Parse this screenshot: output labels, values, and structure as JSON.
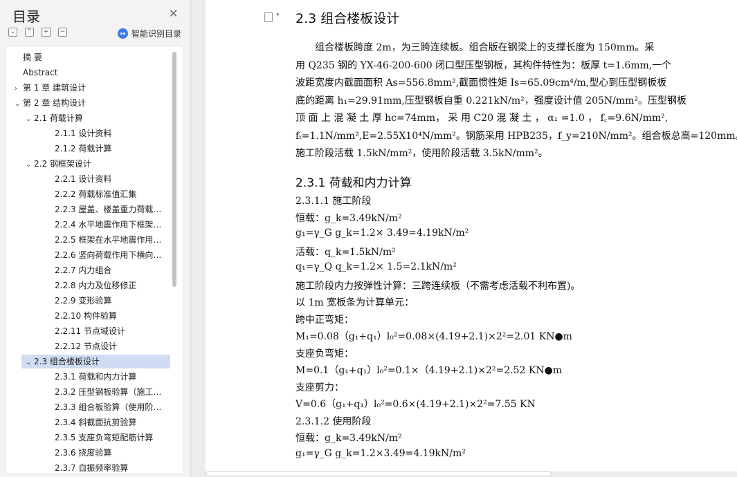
{
  "sidebar": {
    "title": "目录",
    "smart_label": "智能识别目录",
    "items": [
      {
        "label": "摘  要",
        "level": 0,
        "arrow": ""
      },
      {
        "label": "Abstract",
        "level": 0,
        "arrow": ""
      },
      {
        "label": "第 1 章  建筑设计",
        "level": 0,
        "arrow": "›"
      },
      {
        "label": "第 2 章  结构设计",
        "level": 0,
        "arrow": "⌄"
      },
      {
        "label": "2.1  荷载计算",
        "level": 1,
        "arrow": "⌄"
      },
      {
        "label": "2.1.1  设计资料",
        "level": 2,
        "arrow": ""
      },
      {
        "label": "2.1.2  荷载计算",
        "level": 2,
        "arrow": ""
      },
      {
        "label": "2.2  钢框架设计",
        "level": 1,
        "arrow": "⌄"
      },
      {
        "label": "2.2.1  设计资料",
        "level": 2,
        "arrow": ""
      },
      {
        "label": "2.2.2  荷载标准值汇集",
        "level": 2,
        "arrow": ""
      },
      {
        "label": "2.2.3  屋盖、楼盖重力荷载代…",
        "level": 2,
        "arrow": ""
      },
      {
        "label": "2.2.4  水平地震作用下框架的…",
        "level": 2,
        "arrow": ""
      },
      {
        "label": "2.2.5  框架在水平地震作用下…",
        "level": 2,
        "arrow": ""
      },
      {
        "label": "2.2.6  竖向荷载作用下横向框…",
        "level": 2,
        "arrow": ""
      },
      {
        "label": "2.2.7  内力组合",
        "level": 2,
        "arrow": ""
      },
      {
        "label": "2.2.8  内力及位移修正",
        "level": 2,
        "arrow": ""
      },
      {
        "label": "2.2.9  变形验算",
        "level": 2,
        "arrow": ""
      },
      {
        "label": "2.2.10  构件验算",
        "level": 2,
        "arrow": ""
      },
      {
        "label": "2.2.11  节点域设计",
        "level": 2,
        "arrow": ""
      },
      {
        "label": "2.2.12  节点设计",
        "level": 2,
        "arrow": ""
      },
      {
        "label": "2.3  组合楼板设计",
        "level": 1,
        "arrow": "⌄",
        "active": true
      },
      {
        "label": "2.3.1  荷载和内力计算",
        "level": 2,
        "arrow": ""
      },
      {
        "label": "2.3.2  压型钢板验算（施工阶…",
        "level": 2,
        "arrow": ""
      },
      {
        "label": "2.3.3  组合板验算（使用阶段…",
        "level": 2,
        "arrow": ""
      },
      {
        "label": "2.3.4  斜截面抗剪验算",
        "level": 2,
        "arrow": ""
      },
      {
        "label": "2.3.5  支座负弯矩配筋计算",
        "level": 2,
        "arrow": ""
      },
      {
        "label": "2.3.6  挠度验算",
        "level": 2,
        "arrow": ""
      },
      {
        "label": "2.3.7  自振频率验算",
        "level": 2,
        "arrow": ""
      }
    ]
  },
  "doc": {
    "heading": "2.3  组合楼板设计",
    "para": [
      "　　组合楼板跨度 2m，为三跨连续板。组合版在钢梁上的支撑长度为 150mm。采",
      "用 Q235 钢的 YX-46-200-600 闭口型压型钢板，其构件特性为：板厚 t=1.6mm,一个",
      "波距宽度内截面面积 As=556.8mm²,截面惯性矩 Is=65.09cm⁴/m,型心到压型钢板板",
      "底的距离 h₁=29.91mm,压型钢板自重 0.221kN/m²，强度设计值 205N/mm²。压型钢板",
      "顶 面 上 混 凝 土 厚  hc=74mm， 采 用  C20  混 凝 土 ，  α₁ =1.0 ，  f꜀=9.6N/mm²,",
      "fₜ=1.1N/mm²,E=2.55X10⁴N/mm²。钢筋采用 HPB235，f_y=210N/mm²。组合板总高=120mm。",
      "施工阶段活载 1.5kN/mm²，使用阶段活载 3.5kN/mm²。"
    ],
    "sub_heading": "2.3.1  荷载和内力计算",
    "lines": [
      "2.3.1.1   施工阶段",
      "恒载：g_k=3.49kN/m²",
      "g₁=γ_G g_k=1.2× 3.49=4.19kN/m²",
      "活载：q_k=1.5kN/m²",
      "q₁=γ_Q q_k=1.2× 1.5=2.1kN/m²",
      "施工阶段内力按弹性计算：三跨连续板（不需考虑活载不利布置)。",
      "以 1m 宽板条为计算单元：",
      "跨中正弯矩：",
      "M₁=0.08（g₁+q₁）l₀²=0.08×(4.19+2.1)×2²=2.01 KN●m",
      "支座负弯矩：",
      "M=0.1（g₁+q₁）l₀²=0.1×（4.19+2.1)×2²=2.52 KN●m",
      "支座剪力：",
      "V=0.6（g₁+q₁）l₀²=0.6×(4.19+2.1)×2²=7.55 KN",
      "2.3.1.2   使用阶段",
      "恒载：g_k=3.49kN/m²",
      "g₁=γ_G g_k=1.2×3.49=4.19kN/m²"
    ]
  }
}
